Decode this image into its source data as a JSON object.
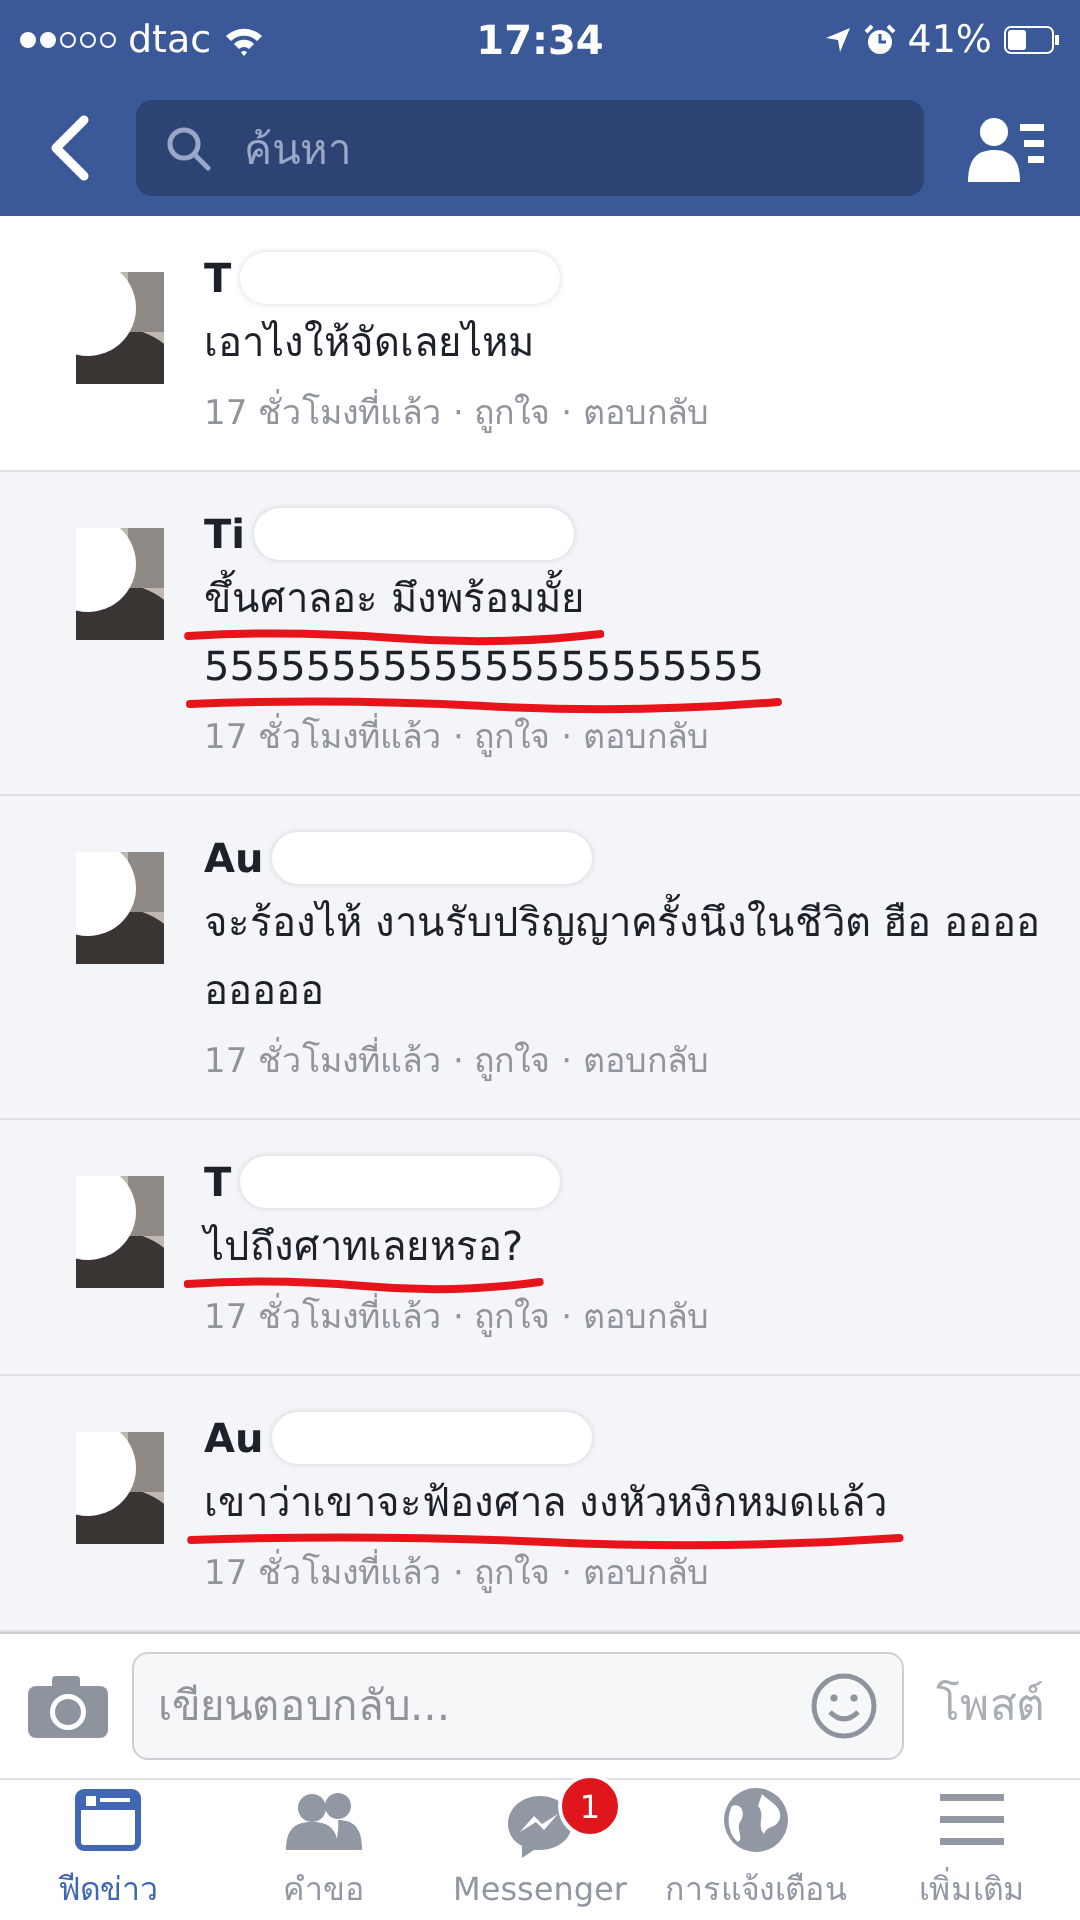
{
  "status_bar": {
    "carrier": "dtac",
    "time": "17:34",
    "battery": "41%"
  },
  "nav": {
    "search": {
      "placeholder": "ค้นหา"
    }
  },
  "comments": [
    {
      "name": "T",
      "text": "เอาไงให้จัดเลยไหม",
      "meta": "17 ชั่วโมงที่แล้ว · ถูกใจ · ตอบกลับ",
      "highlighted": false,
      "underlined": false
    },
    {
      "name": "Ti",
      "text": "ขึ้นศาลอะ มึงพร้อมมั้ย\n5555555555555555555555",
      "meta": "17 ชั่วโมงที่แล้ว · ถูกใจ · ตอบกลับ",
      "highlighted": true,
      "underlined": true
    },
    {
      "name": "Au",
      "text": "จะร้องไห้ งานรับปริญญาครั้งนึงในชีวิต ฮือ อออออออออ",
      "meta": "17 ชั่วโมงที่แล้ว · ถูกใจ · ตอบกลับ",
      "highlighted": true,
      "underlined": false
    },
    {
      "name": "T",
      "text": "ไปถึงศาทเลยหรอ?",
      "meta": "17 ชั่วโมงที่แล้ว · ถูกใจ · ตอบกลับ",
      "highlighted": true,
      "underlined": true
    },
    {
      "name": "Au",
      "text": "เขาว่าเขาจะฟ้องศาล งงหัวหงิกหมดแล้ว",
      "meta": "17 ชั่วโมงที่แล้ว · ถูกใจ · ตอบกลับ",
      "highlighted": true,
      "underlined": true
    }
  ],
  "composer": {
    "placeholder": "เขียนตอบกลับ...",
    "post": "โพสต์"
  },
  "tabs": [
    {
      "kind": "feed",
      "label": "ฟีดข่าว",
      "selected": true
    },
    {
      "kind": "friends",
      "label": "คำขอ",
      "selected": false
    },
    {
      "kind": "messenger",
      "label": "Messenger",
      "selected": false,
      "badge": "1"
    },
    {
      "kind": "globe",
      "label": "การแจ้งเตือน",
      "selected": false
    },
    {
      "kind": "menu",
      "label": "เพิ่มเติม",
      "selected": false
    }
  ]
}
